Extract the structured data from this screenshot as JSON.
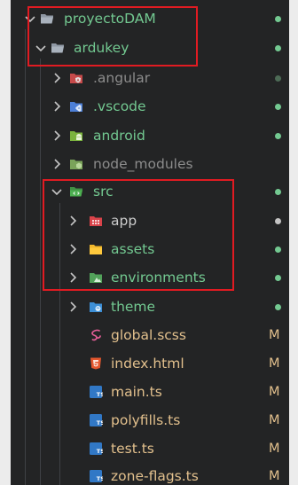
{
  "colors": {
    "panel_bg": "#232425",
    "text_default": "#cccccc",
    "text_faded": "#8c8c8c",
    "git_green": "#73c991",
    "git_modified": "#e2c08d",
    "highlight_red": "#e11b22"
  },
  "explorer": {
    "items": [
      {
        "label": "proyectoDAM",
        "icon": "folder-open-icon",
        "expanded": true,
        "depth": 0,
        "status": "dot"
      },
      {
        "label": "ardukey",
        "icon": "folder-open-icon",
        "expanded": true,
        "depth": 1,
        "status": "dot"
      },
      {
        "label": ".angular",
        "icon": "angular-folder-icon",
        "expanded": false,
        "depth": 2,
        "status": "dot-faded"
      },
      {
        "label": ".vscode",
        "icon": "vscode-folder-icon",
        "expanded": false,
        "depth": 2,
        "status": "dot"
      },
      {
        "label": "android",
        "icon": "android-folder-icon",
        "expanded": false,
        "depth": 2,
        "status": "dot"
      },
      {
        "label": "node_modules",
        "icon": "node-folder-icon",
        "expanded": false,
        "depth": 2,
        "status": "none"
      },
      {
        "label": "src",
        "icon": "src-folder-icon",
        "expanded": true,
        "depth": 2,
        "status": "dot"
      },
      {
        "label": "app",
        "icon": "app-folder-icon",
        "expanded": false,
        "depth": 3,
        "status": "dot-grey"
      },
      {
        "label": "assets",
        "icon": "assets-folder-icon",
        "expanded": false,
        "depth": 3,
        "status": "dot"
      },
      {
        "label": "environments",
        "icon": "environments-folder-icon",
        "expanded": false,
        "depth": 3,
        "status": "dot"
      },
      {
        "label": "theme",
        "icon": "theme-folder-icon",
        "expanded": false,
        "depth": 3,
        "status": "dot"
      },
      {
        "label": "global.scss",
        "icon": "sass-file-icon",
        "depth": 3,
        "status": "M"
      },
      {
        "label": "index.html",
        "icon": "html-file-icon",
        "depth": 3,
        "status": "M"
      },
      {
        "label": "main.ts",
        "icon": "typescript-file-icon",
        "depth": 3,
        "status": "M"
      },
      {
        "label": "polyfills.ts",
        "icon": "typescript-file-icon",
        "depth": 3,
        "status": "M"
      },
      {
        "label": "test.ts",
        "icon": "typescript-file-icon",
        "depth": 3,
        "status": "M"
      },
      {
        "label": "zone-flags.ts",
        "icon": "typescript-file-icon",
        "depth": 3,
        "status": "M"
      }
    ]
  }
}
